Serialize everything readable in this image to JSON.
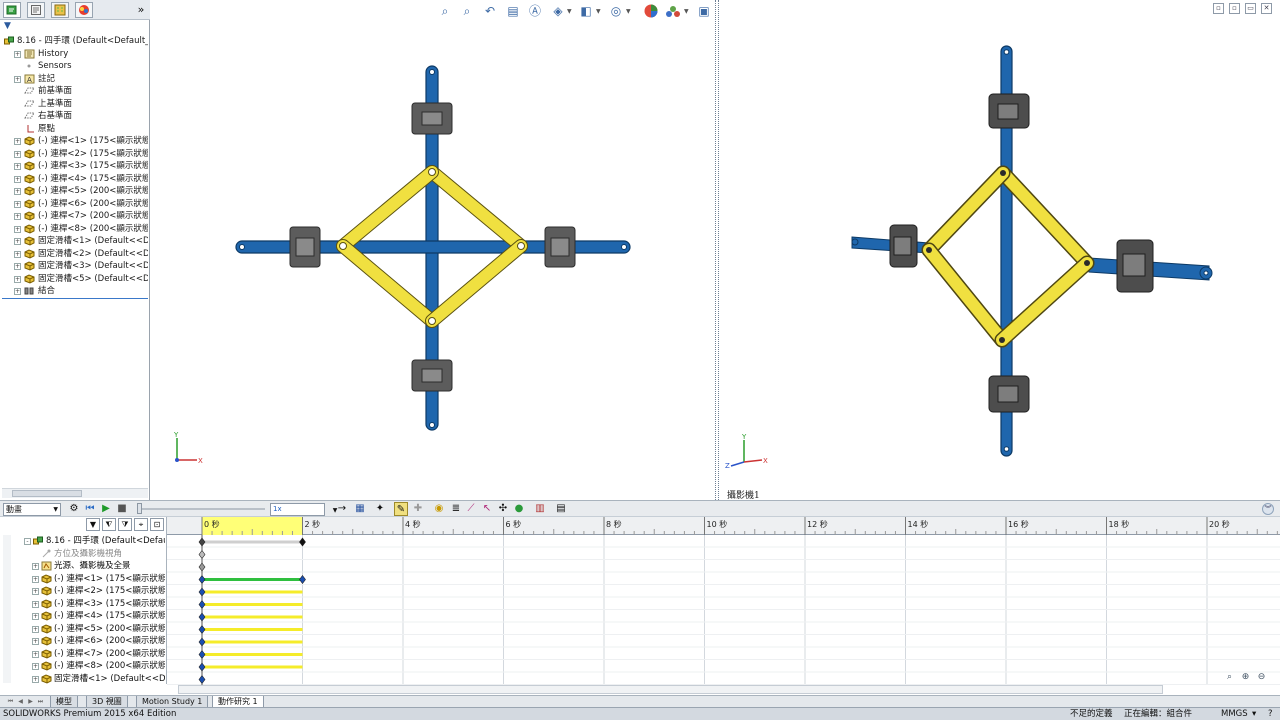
{
  "feature_manager": {
    "tabs": [
      {
        "icon": "feature-tree-icon",
        "active": true
      },
      {
        "icon": "property-manager-icon",
        "active": false
      },
      {
        "icon": "configuration-manager-icon",
        "active": false
      },
      {
        "icon": "display-manager-icon",
        "active": false
      }
    ],
    "expand_label": "»",
    "filter_label": "▼",
    "tree": [
      {
        "label": "8.16 - 四手環  (Default<Default_D",
        "icon": "assembly-icon",
        "indent": 0,
        "expander": ""
      },
      {
        "label": "History",
        "icon": "history-icon",
        "indent": 1,
        "expander": "+"
      },
      {
        "label": "Sensors",
        "icon": "sensors-icon",
        "indent": 1,
        "expander": ""
      },
      {
        "label": "註記",
        "icon": "annotations-icon",
        "indent": 1,
        "expander": "+"
      },
      {
        "label": "前基準面",
        "icon": "plane-icon",
        "indent": 1,
        "expander": ""
      },
      {
        "label": "上基準面",
        "icon": "plane-icon",
        "indent": 1,
        "expander": ""
      },
      {
        "label": "右基準面",
        "icon": "plane-icon",
        "indent": 1,
        "expander": ""
      },
      {
        "label": "原點",
        "icon": "origin-icon",
        "indent": 1,
        "expander": ""
      },
      {
        "label": "(-) 連桿<1> (175<顯示狀態-8>",
        "icon": "part-icon",
        "indent": 1,
        "expander": "+"
      },
      {
        "label": "(-) 連桿<2> (175<顯示狀態-8>",
        "icon": "part-icon",
        "indent": 1,
        "expander": "+"
      },
      {
        "label": "(-) 連桿<3> (175<顯示狀態-8>",
        "icon": "part-icon",
        "indent": 1,
        "expander": "+"
      },
      {
        "label": "(-) 連桿<4> (175<顯示狀態-8>",
        "icon": "part-icon",
        "indent": 1,
        "expander": "+"
      },
      {
        "label": "(-) 連桿<5> (200<顯示狀態-9>",
        "icon": "part-icon",
        "indent": 1,
        "expander": "+"
      },
      {
        "label": "(-) 連桿<6> (200<顯示狀態-9>",
        "icon": "part-icon",
        "indent": 1,
        "expander": "+"
      },
      {
        "label": "(-) 連桿<7> (200<顯示狀態-9>",
        "icon": "part-icon",
        "indent": 1,
        "expander": "+"
      },
      {
        "label": "(-) 連桿<8> (200<顯示狀態-9>",
        "icon": "part-icon",
        "indent": 1,
        "expander": "+"
      },
      {
        "label": "固定滑槽<1> (Default<<Defa",
        "icon": "part-icon",
        "indent": 1,
        "expander": "+"
      },
      {
        "label": "固定滑槽<2> (Default<<Defa",
        "icon": "part-icon",
        "indent": 1,
        "expander": "+"
      },
      {
        "label": "固定滑槽<3> (Default<<Defa",
        "icon": "part-icon",
        "indent": 1,
        "expander": "+"
      },
      {
        "label": "固定滑槽<5> (Default<<Defa",
        "icon": "part-icon",
        "indent": 1,
        "expander": "+"
      },
      {
        "label": "結合",
        "icon": "mates-icon",
        "indent": 1,
        "expander": "+"
      }
    ]
  },
  "viewport_right": {
    "camera_label": "攝影機1",
    "controls": [
      "▫",
      "▫",
      "▭",
      "✕"
    ]
  },
  "motion": {
    "study_type": "動畫",
    "speed_value": "1x",
    "ruler_labels": [
      "0 秒",
      "2 秒",
      "4 秒",
      "6 秒",
      "8 秒",
      "10 秒",
      "12 秒",
      "14 秒",
      "16 秒",
      "18 秒",
      "20 秒"
    ],
    "tree": [
      {
        "label": "8.16 - 四手環  (Default<Default",
        "icon": "assembly-icon",
        "indent": 0,
        "expander": "-"
      },
      {
        "label": "方位及攝影機視角",
        "icon": "orientation-icon",
        "indent": 1,
        "expander": "",
        "muted": true
      },
      {
        "label": "光源、攝影機及全景",
        "icon": "lights-icon",
        "indent": 1,
        "expander": "+"
      },
      {
        "label": "(-) 連桿<1> (175<顯示狀態",
        "icon": "part-icon",
        "indent": 1,
        "expander": "+"
      },
      {
        "label": "(-) 連桿<2> (175<顯示狀態",
        "icon": "part-icon",
        "indent": 1,
        "expander": "+"
      },
      {
        "label": "(-) 連桿<3> (175<顯示狀態",
        "icon": "part-icon",
        "indent": 1,
        "expander": "+"
      },
      {
        "label": "(-) 連桿<4> (175<顯示狀態",
        "icon": "part-icon",
        "indent": 1,
        "expander": "+"
      },
      {
        "label": "(-) 連桿<5> (200<顯示狀態",
        "icon": "part-icon",
        "indent": 1,
        "expander": "+"
      },
      {
        "label": "(-) 連桿<6> (200<顯示狀態",
        "icon": "part-icon",
        "indent": 1,
        "expander": "+"
      },
      {
        "label": "(-) 連桿<7> (200<顯示狀態",
        "icon": "part-icon",
        "indent": 1,
        "expander": "+"
      },
      {
        "label": "(-) 連桿<8> (200<顯示狀態",
        "icon": "part-icon",
        "indent": 1,
        "expander": "+"
      },
      {
        "label": "固定滑槽<1> (Default<<De",
        "icon": "part-icon",
        "indent": 1,
        "expander": "+"
      }
    ]
  },
  "sheet_tabs": [
    {
      "label": "模型",
      "active": false
    },
    {
      "label": "3D 視圖",
      "active": false
    },
    {
      "label": "Motion Study 1",
      "active": false
    },
    {
      "label": "動作研究 1",
      "active": true
    }
  ],
  "status_bar": {
    "product": "SOLIDWORKS Premium 2015 x64 Edition",
    "definition": "不足的定義",
    "editing": "正在編輯：組合件",
    "units": "MMGS",
    "units_arrow": "▾",
    "help": "?"
  },
  "colors": {
    "link_blue": "#1f66ad",
    "link_yellow": "#f0e040",
    "slot_gray": "#5a5a5a",
    "timeline_highlight": "#ffff77",
    "key_green": "#2fbf3f"
  }
}
